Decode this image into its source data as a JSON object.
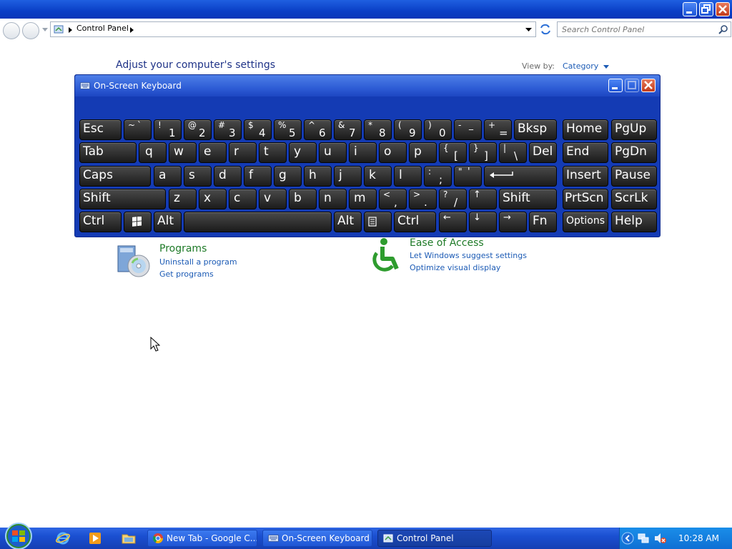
{
  "breadcrumb": {
    "item": "Control Panel"
  },
  "search": {
    "placeholder": "Search Control Panel"
  },
  "page": {
    "heading": "Adjust your computer's settings",
    "view_by_label": "View by:",
    "view_by_value": "Category"
  },
  "osk": {
    "title": "On-Screen Keyboard",
    "keys": {
      "esc": "Esc",
      "bksp": "Bksp",
      "home": "Home",
      "pgup": "PgUp",
      "tab": "Tab",
      "del": "Del",
      "end": "End",
      "pgdn": "PgDn",
      "caps": "Caps",
      "insert": "Insert",
      "pause": "Pause",
      "shift_l": "Shift",
      "shift_r": "Shift",
      "prtscn": "PrtScn",
      "scrlk": "ScrLk",
      "ctrl_l": "Ctrl",
      "alt_l": "Alt",
      "alt_r": "Alt",
      "ctrl_r": "Ctrl",
      "fn": "Fn",
      "options": "Options",
      "help": "Help",
      "q": "q",
      "w": "w",
      "e": "e",
      "r": "r",
      "t": "t",
      "y": "y",
      "u": "u",
      "i": "i",
      "o": "o",
      "p": "p",
      "a": "a",
      "s": "s",
      "d": "d",
      "f": "f",
      "g": "g",
      "h": "h",
      "j": "j",
      "k": "k",
      "l": "l",
      "z": "z",
      "x": "x",
      "c": "c",
      "v": "v",
      "b": "b",
      "n": "n",
      "m": "m",
      "tilde_top": "~",
      "tilde_bot": "`",
      "n1_top": "!",
      "n1_bot": "1",
      "n2_top": "@",
      "n2_bot": "2",
      "n3_top": "#",
      "n3_bot": "3",
      "n4_top": "$",
      "n4_bot": "4",
      "n5_top": "%",
      "n5_bot": "5",
      "n6_top": "^",
      "n6_bot": "6",
      "n7_top": "&",
      "n7_bot": "7",
      "n8_top": "*",
      "n8_bot": "8",
      "n9_top": "(",
      "n9_bot": "9",
      "n0_top": ")",
      "n0_bot": "0",
      "minus_top": "-",
      "minus_bot": "_",
      "plus_top": "+",
      "plus_bot": "=",
      "lbr_top": "{",
      "lbr_bot": "[",
      "rbr_top": "}",
      "rbr_bot": "]",
      "bs_top": "|",
      "bs_bot": "\\",
      "semi_top": ":",
      "semi_bot": ";",
      "quote_top": "\"",
      "quote_bot": "'",
      "comma_top": "<",
      "comma_bot": ",",
      "period_top": ">",
      "period_bot": ".",
      "slash_top": "?",
      "slash_bot": "/",
      "up": "↑",
      "left": "←",
      "down": "↓",
      "right": "→"
    }
  },
  "programs": {
    "title": "Programs",
    "link1": "Uninstall a program",
    "link2": "Get programs"
  },
  "ease": {
    "title": "Ease of Access",
    "link1": "Let Windows suggest settings",
    "link2": "Optimize visual display"
  },
  "taskbar": {
    "tasks": [
      "New Tab - Google C...",
      "On-Screen Keyboard",
      "Control Panel"
    ],
    "clock": "10:28 AM"
  },
  "colors": {
    "titlebar": "#0a3fc6",
    "osk_bg": "#143bb4",
    "heading": "#1e3287",
    "link": "#1c5bb5",
    "green_title": "#1e7a27"
  }
}
